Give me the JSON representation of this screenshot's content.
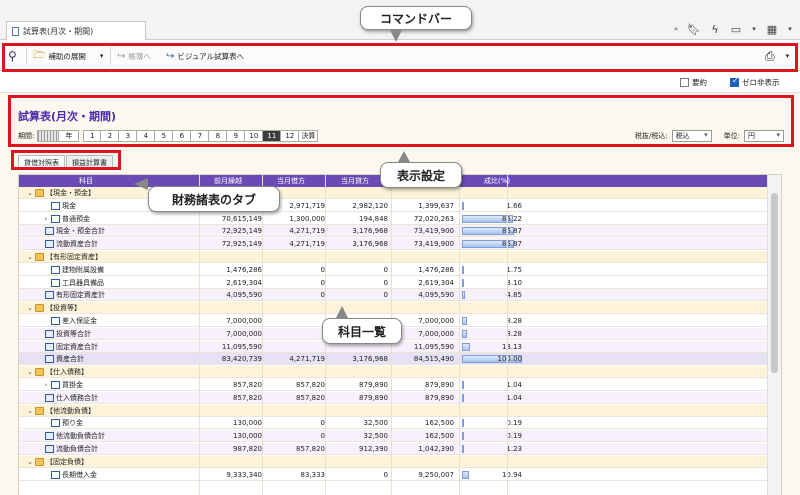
{
  "window": {
    "tab_title": "試算表(月次・期間)"
  },
  "toolbar": {
    "expand_label": "補助の展開",
    "ledger_label": "帳簿へ",
    "visual_label": "ビジュアル試算表へ"
  },
  "options": {
    "summary_label": "要約",
    "zero_hide_label": "ゼロ非表示",
    "summary_checked": false,
    "zero_hide_checked": true
  },
  "page": {
    "title": "試算表(月次・期間)",
    "period_label": "期間:",
    "year_label": "年",
    "period_buttons": [
      "1",
      "2",
      "3",
      "4",
      "5",
      "6",
      "7",
      "8",
      "9",
      "10",
      "11",
      "12",
      "決算"
    ],
    "active_period": "11",
    "tax_label": "税抜/税込:",
    "tax_value": "税込",
    "unit_label": "単位:",
    "unit_value": "円"
  },
  "sheet_tabs": {
    "bs": "貸借対照表",
    "pl": "損益計算書"
  },
  "table": {
    "headers": [
      "科目",
      "前月繰越",
      "当月借方",
      "当月貸方",
      "",
      "成比(%)"
    ],
    "rows": [
      {
        "type": "sec",
        "icon": "folder",
        "exp": "⌄",
        "name": "【現金・預金】",
        "v": [
          "",
          "",
          "",
          "",
          ""
        ],
        "ratio": null
      },
      {
        "type": "item",
        "icon": "item",
        "exp": "",
        "name": "現金",
        "v": [
          "",
          "2,971,719",
          "2,982,120",
          "1,399,637",
          "1.66"
        ],
        "ratio": 1.66
      },
      {
        "type": "item",
        "icon": "item",
        "exp": "›",
        "name": "普通預金",
        "v": [
          "70,615,149",
          "1,300,000",
          "194,848",
          "72,020,263",
          "85.22"
        ],
        "ratio": 85.22
      },
      {
        "type": "sub",
        "icon": "sum",
        "exp": "",
        "name": "現金・預金合計",
        "v": [
          "72,925,149",
          "4,271,719",
          "3,176,968",
          "73,419,900",
          "86.87"
        ],
        "ratio": 86.87
      },
      {
        "type": "sub",
        "icon": "sum",
        "exp": "",
        "name": "流動資産合計",
        "v": [
          "72,925,149",
          "4,271,719",
          "3,176,968",
          "73,419,900",
          "86.87"
        ],
        "ratio": 86.87
      },
      {
        "type": "sec",
        "icon": "folder",
        "exp": "⌄",
        "name": "【有形固定資産】",
        "v": [
          "",
          "",
          "",
          "",
          ""
        ],
        "ratio": null
      },
      {
        "type": "item",
        "icon": "item",
        "exp": "",
        "name": "建物附属設備",
        "v": [
          "1,476,286",
          "0",
          "0",
          "1,476,286",
          "1.75"
        ],
        "ratio": 1.75
      },
      {
        "type": "item",
        "icon": "item",
        "exp": "",
        "name": "工具器具備品",
        "v": [
          "2,619,304",
          "0",
          "0",
          "2,619,304",
          "3.10"
        ],
        "ratio": 3.1
      },
      {
        "type": "sub",
        "icon": "sum",
        "exp": "",
        "name": "有形固定資産計",
        "v": [
          "4,095,590",
          "0",
          "0",
          "4,095,590",
          "4.85"
        ],
        "ratio": 4.85
      },
      {
        "type": "sec",
        "icon": "folder",
        "exp": "⌄",
        "name": "【投資等】",
        "v": [
          "",
          "",
          "",
          "",
          ""
        ],
        "ratio": null
      },
      {
        "type": "item",
        "icon": "item",
        "exp": "",
        "name": "差入保証金",
        "v": [
          "7,000,000",
          "",
          "",
          "7,000,000",
          "8.28"
        ],
        "ratio": 8.28
      },
      {
        "type": "sub",
        "icon": "sum",
        "exp": "",
        "name": "投資等合計",
        "v": [
          "7,000,000",
          "",
          "",
          "7,000,000",
          "8.28"
        ],
        "ratio": 8.28
      },
      {
        "type": "sub",
        "icon": "sum",
        "exp": "",
        "name": "固定資産合計",
        "v": [
          "11,095,590",
          "",
          "",
          "11,095,590",
          "13.13"
        ],
        "ratio": 13.13
      },
      {
        "type": "tot",
        "icon": "sum",
        "exp": "",
        "name": "資産合計",
        "v": [
          "83,420,739",
          "4,271,719",
          "3,176,968",
          "84,515,490",
          "100.00"
        ],
        "ratio": 100
      },
      {
        "type": "sec",
        "icon": "folder",
        "exp": "⌄",
        "name": "【仕入債務】",
        "v": [
          "",
          "",
          "",
          "",
          ""
        ],
        "ratio": null
      },
      {
        "type": "item",
        "icon": "item",
        "exp": "›",
        "name": "買掛金",
        "v": [
          "857,820",
          "857,820",
          "879,890",
          "879,890",
          "1.04"
        ],
        "ratio": 1.04
      },
      {
        "type": "sub",
        "icon": "sum",
        "exp": "",
        "name": "仕入債務合計",
        "v": [
          "857,820",
          "857,820",
          "879,890",
          "879,890",
          "1.04"
        ],
        "ratio": 1.04
      },
      {
        "type": "sec",
        "icon": "folder",
        "exp": "⌄",
        "name": "【他流動負債】",
        "v": [
          "",
          "",
          "",
          "",
          ""
        ],
        "ratio": null
      },
      {
        "type": "item",
        "icon": "item",
        "exp": "",
        "name": "預り金",
        "v": [
          "130,000",
          "0",
          "32,500",
          "162,500",
          "0.19"
        ],
        "ratio": 0.19
      },
      {
        "type": "sub",
        "icon": "sum",
        "exp": "",
        "name": "他流動負債合計",
        "v": [
          "130,000",
          "0",
          "32,500",
          "162,500",
          "0.19"
        ],
        "ratio": 0.19
      },
      {
        "type": "sub",
        "icon": "sum",
        "exp": "",
        "name": "流動負債合計",
        "v": [
          "987,820",
          "857,820",
          "912,390",
          "1,042,390",
          "1.23"
        ],
        "ratio": 1.23
      },
      {
        "type": "sec",
        "icon": "folder",
        "exp": "⌄",
        "name": "【固定負債】",
        "v": [
          "",
          "",
          "",
          "",
          ""
        ],
        "ratio": null
      },
      {
        "type": "item",
        "icon": "item",
        "exp": "",
        "name": "長期借入金",
        "v": [
          "9,333,340",
          "83,333",
          "0",
          "9,250,007",
          "10.94"
        ],
        "ratio": 10.94
      }
    ]
  },
  "callouts": {
    "command_bar": "コマンドバー",
    "display_settings": "表示設定",
    "fin_tabs": "財務諸表のタブ",
    "account_list": "科目一覧"
  },
  "colors": {
    "highlight": "#e0141e",
    "header": "#6a4bb5",
    "title": "#4b2aa8"
  }
}
